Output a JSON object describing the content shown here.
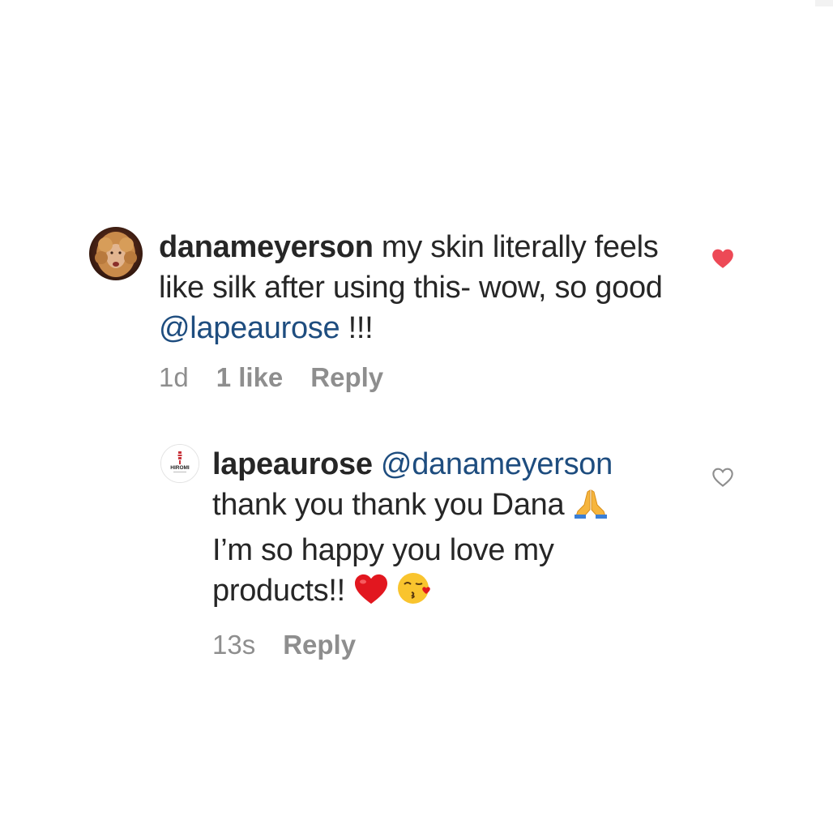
{
  "comment": {
    "username": "danameyerson",
    "text_before": " my skin literally feels like silk after using this- wow, so good ",
    "mention": "@lapeaurose",
    "text_after": " !!!",
    "time": "1d",
    "likes": "1 like",
    "reply_label": "Reply",
    "liked": true,
    "like_color": "#ed4956"
  },
  "reply": {
    "username": "lapeaurose",
    "mention": "@danameyerson",
    "line1": "thank you thank you Dana ",
    "line2": "I’m so happy you love my products!! ",
    "avatar_brand": "HIROMI",
    "time": "13s",
    "reply_label": "Reply",
    "liked": false,
    "emojis": [
      "folded-hands",
      "red-heart",
      "face-blowing-a-kiss"
    ]
  },
  "colors": {
    "text": "#262626",
    "muted": "#8e8e8e",
    "mention": "#1e4d7f"
  }
}
